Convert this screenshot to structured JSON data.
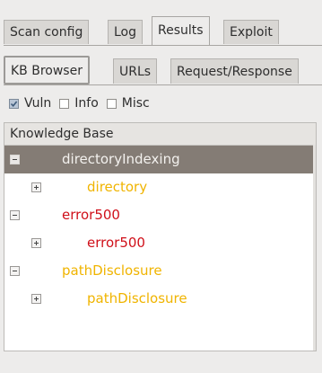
{
  "tabs": [
    {
      "label": "Scan config",
      "active": false
    },
    {
      "label": "Log",
      "active": false
    },
    {
      "label": "Results",
      "active": true
    },
    {
      "label": "Exploit",
      "active": false
    }
  ],
  "subtabs": [
    {
      "label": "KB Browser",
      "active": true
    },
    {
      "label": "URLs",
      "active": false
    },
    {
      "label": "Request/Response",
      "active": false
    }
  ],
  "filters": [
    {
      "label": "Vuln",
      "checked": true
    },
    {
      "label": "Info",
      "checked": false
    },
    {
      "label": "Misc",
      "checked": false
    }
  ],
  "tree": {
    "header": "Knowledge Base",
    "rows": [
      {
        "label": "directoryIndexing",
        "level": 0,
        "expanded": true,
        "selected": true,
        "color": "#f3f1ee"
      },
      {
        "label": "directory",
        "level": 1,
        "expanded": false,
        "selected": false,
        "color": "#f0b400"
      },
      {
        "label": "error500",
        "level": 0,
        "expanded": true,
        "selected": false,
        "color": "#d0101a"
      },
      {
        "label": "error500",
        "level": 1,
        "expanded": false,
        "selected": false,
        "color": "#d0101a"
      },
      {
        "label": "pathDisclosure",
        "level": 0,
        "expanded": true,
        "selected": false,
        "color": "#f0b400"
      },
      {
        "label": "pathDisclosure",
        "level": 1,
        "expanded": false,
        "selected": false,
        "color": "#f0b400"
      }
    ]
  },
  "colors": {
    "selected_row": "#847c75",
    "vuln_red": "#d0101a",
    "info_yellow": "#f0b400"
  }
}
